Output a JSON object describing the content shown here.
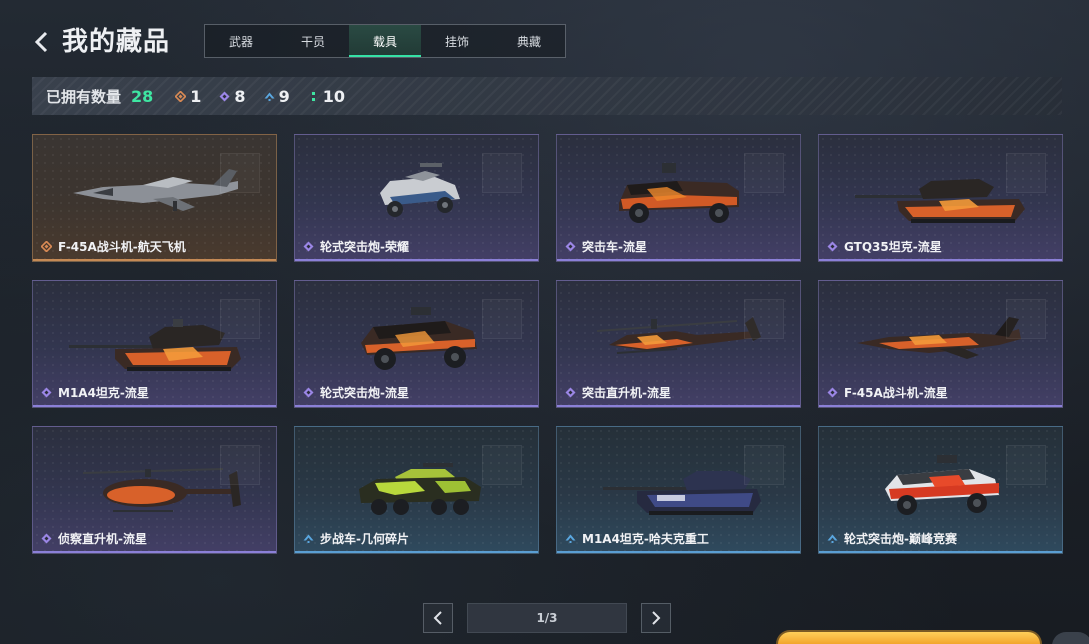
{
  "header": {
    "title": "我的藏品",
    "back_icon": "chevron-left-icon"
  },
  "tabs": [
    {
      "label": "武器",
      "active": false
    },
    {
      "label": "干员",
      "active": false
    },
    {
      "label": "载具",
      "active": true
    },
    {
      "label": "挂饰",
      "active": false
    },
    {
      "label": "典藏",
      "active": false
    }
  ],
  "summary": {
    "label": "已拥有数量",
    "total": "28",
    "rarities": [
      {
        "icon": "gold-diamond-icon",
        "color": "#d98a54",
        "count": "1"
      },
      {
        "icon": "purple-diamond-icon",
        "color": "#9b86e6",
        "count": "8"
      },
      {
        "icon": "blue-chevron-icon",
        "color": "#5aa7e0",
        "count": "9"
      },
      {
        "icon": "green-dots-icon",
        "color": "#3ee6a2",
        "count": "10"
      }
    ]
  },
  "colors": {
    "accent_green": "#3ee6a2",
    "rarity_gold": "#d98a54",
    "rarity_purple": "#9b86e6",
    "rarity_blue": "#5aa7e0"
  },
  "items": [
    {
      "name": "F-45A战斗机-航天飞机",
      "rarity": "gold",
      "vehicle": "jet-icon"
    },
    {
      "name": "轮式突击炮-荣耀",
      "rarity": "purple",
      "vehicle": "armored-car-icon"
    },
    {
      "name": "突击车-流星",
      "rarity": "purple",
      "vehicle": "assault-truck-icon"
    },
    {
      "name": "GTQ35坦克-流星",
      "rarity": "purple",
      "vehicle": "tank-icon"
    },
    {
      "name": "M1A4坦克-流星",
      "rarity": "purple",
      "vehicle": "tank-icon"
    },
    {
      "name": "轮式突击炮-流星",
      "rarity": "purple",
      "vehicle": "armored-car-icon"
    },
    {
      "name": "突击直升机-流星",
      "rarity": "purple",
      "vehicle": "attack-helicopter-icon"
    },
    {
      "name": "F-45A战斗机-流星",
      "rarity": "purple",
      "vehicle": "jet-icon"
    },
    {
      "name": "侦察直升机-流星",
      "rarity": "purple",
      "vehicle": "scout-helicopter-icon"
    },
    {
      "name": "步战车-几何碎片",
      "rarity": "blue",
      "vehicle": "ifv-icon"
    },
    {
      "name": "M1A4坦克-哈夫克重工",
      "rarity": "blue",
      "vehicle": "tank-icon"
    },
    {
      "name": "轮式突击炮-巅峰竞赛",
      "rarity": "blue",
      "vehicle": "armored-car-icon"
    }
  ],
  "pagination": {
    "current": "1/3",
    "prev_icon": "chevron-left-icon",
    "next_icon": "chevron-right-icon"
  }
}
